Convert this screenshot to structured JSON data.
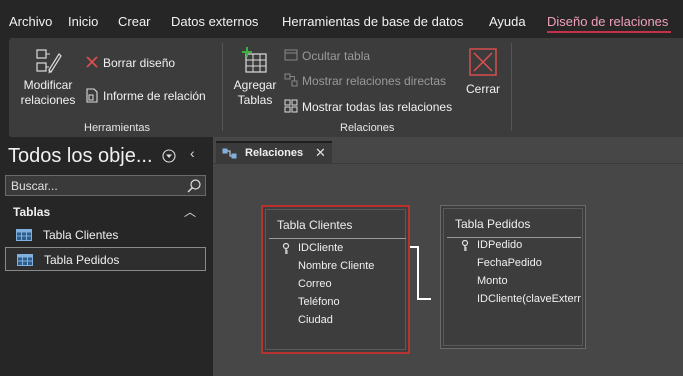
{
  "menu": {
    "items": [
      "Archivo",
      "Inicio",
      "Crear",
      "Datos externos",
      "Herramientas de base de datos",
      "Ayuda",
      "Diseño de relaciones"
    ],
    "active_index": 6
  },
  "ribbon": {
    "herramientas": {
      "label": "Herramientas",
      "modificar_line1": "Modificar",
      "modificar_line2": "relaciones",
      "borrar": "Borrar diseño",
      "informe": "Informe de relación"
    },
    "relaciones": {
      "label": "Relaciones",
      "agregar_line1": "Agregar",
      "agregar_line2": "Tablas",
      "ocultar": "Ocultar tabla",
      "mostrar_directas": "Mostrar relaciones directas",
      "mostrar_todas": "Mostrar todas las relaciones"
    },
    "cerrar": "Cerrar"
  },
  "nav": {
    "title": "Todos los obje...",
    "search_placeholder": "Buscar...",
    "section": "Tablas",
    "items": [
      {
        "label": "Tabla Clientes",
        "selected": false
      },
      {
        "label": "Tabla Pedidos",
        "selected": true
      }
    ]
  },
  "document": {
    "tab_label": "Relaciones",
    "tables": [
      {
        "title": "Tabla Clientes",
        "selected": true,
        "fields": [
          "IDCliente",
          "Nombre Cliente",
          "Correo",
          "Teléfono",
          "Ciudad"
        ],
        "key_field": "IDCliente"
      },
      {
        "title": "Tabla Pedidos",
        "selected": false,
        "fields": [
          "IDPedido",
          "FechaPedido",
          "Monto",
          "IDCliente(claveExterr"
        ],
        "key_field": "IDPedido"
      }
    ]
  },
  "colors": {
    "accent": "#c4314b",
    "selection_border": "#b83232",
    "ribbon_bg": "#3c3c3c",
    "canvas_bg": "#474747"
  }
}
